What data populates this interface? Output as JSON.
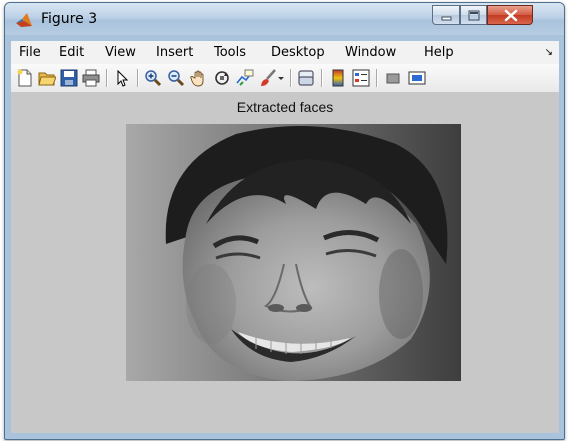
{
  "window": {
    "title": "Figure 3"
  },
  "menu": {
    "items": [
      "File",
      "Edit",
      "View",
      "Insert",
      "Tools",
      "Desktop",
      "Window",
      "Help"
    ],
    "overflow_arrow": "↘"
  },
  "toolbar": {
    "icons": [
      "new-figure-icon",
      "open-file-icon",
      "save-icon",
      "print-icon",
      "select-arrow-icon",
      "zoom-in-icon",
      "zoom-out-icon",
      "pan-hand-icon",
      "rotate-3d-icon",
      "data-cursor-icon",
      "brush-icon",
      "brush-dropdown-icon",
      "link-plot-icon",
      "colorbar-icon",
      "legend-icon",
      "hide-plot-tools-icon",
      "show-plot-tools-icon"
    ]
  },
  "axes": {
    "title": "Extracted faces",
    "image": "grayscale-face-photo"
  },
  "colors": {
    "figure_background": "#c8c8c8",
    "close_button": "#c9412a",
    "titlebar": "#bcd1e6"
  }
}
